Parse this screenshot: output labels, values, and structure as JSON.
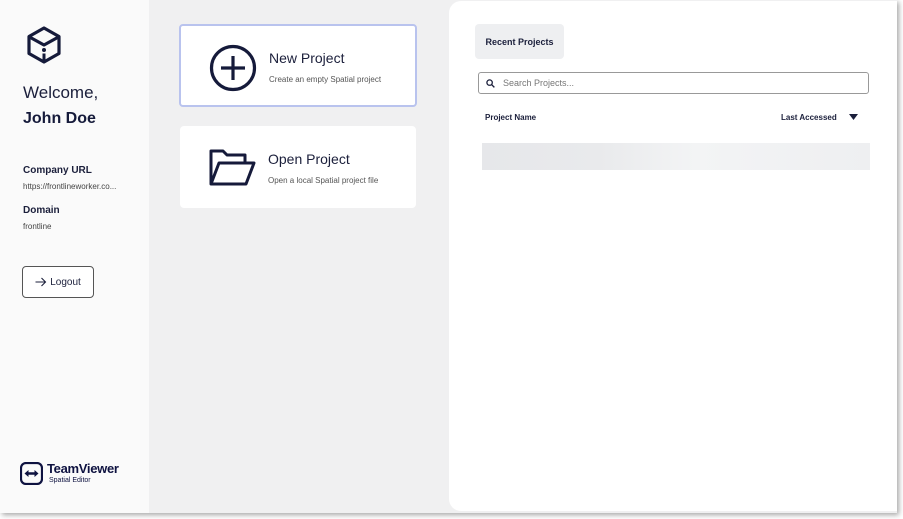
{
  "sidebar": {
    "welcome": "Welcome,",
    "username": "John Doe",
    "company_url_label": "Company URL",
    "company_url_value": "https://frontlineworker.co...",
    "domain_label": "Domain",
    "domain_value": "frontline",
    "logout_label": "Logout",
    "brand_name": "TeamViewer",
    "brand_sub": "Spatial Editor"
  },
  "actions": {
    "new_project": {
      "title": "New Project",
      "description": "Create an empty Spatial project",
      "icon": "plus-circle-icon"
    },
    "open_project": {
      "title": "Open Project",
      "description": "Open a local Spatial project file",
      "icon": "folder-open-icon"
    }
  },
  "recent": {
    "tab_label": "Recent Projects",
    "search_placeholder": "Search Projects...",
    "col_name": "Project Name",
    "col_accessed": "Last Accessed"
  },
  "colors": {
    "navy": "#1b1f3b",
    "selected_border": "#b9c3ee",
    "background": "#f0f0f1"
  }
}
